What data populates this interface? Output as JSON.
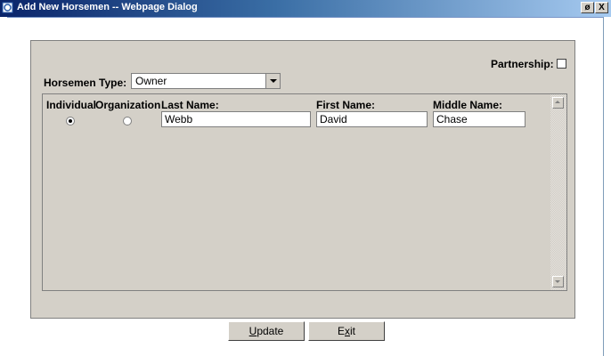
{
  "window": {
    "title": "Add New Horsemen -- Webpage Dialog",
    "restore_glyph": "ø",
    "close_glyph": "X",
    "icon": "ie-page-icon"
  },
  "form": {
    "partnership_label": "Partnership:",
    "partnership_checked": false,
    "horsemen_type_label": "Horsemen Type:",
    "horsemen_type_value": "Owner"
  },
  "table": {
    "headers": {
      "individual": "Individual",
      "organization": "Organization",
      "last_name": "Last Name:",
      "first_name": "First Name:",
      "middle_name": "Middle Name:"
    },
    "row": {
      "entity_type": "Individual",
      "last_name": "Webb",
      "first_name": "David",
      "middle_name": "Chase"
    }
  },
  "buttons": {
    "update_mnemonic": "U",
    "update_rest": "pdate",
    "exit_first": "E",
    "exit_mnemonic": "x",
    "exit_rest": "it"
  }
}
